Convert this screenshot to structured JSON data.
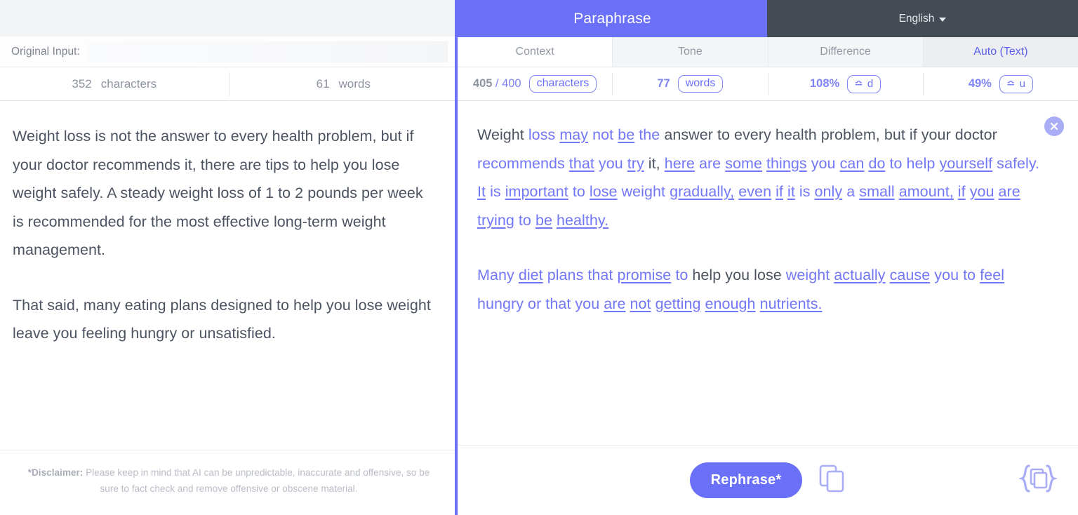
{
  "left": {
    "original_input_label": "Original Input:",
    "stats": [
      {
        "value": "352",
        "unit": "characters"
      },
      {
        "value": "61",
        "unit": "words"
      }
    ],
    "paragraphs": [
      "Weight loss is not the answer to every health problem, but if your doctor recommends it, there are tips to help you lose weight safely. A steady weight loss of 1 to 2 pounds per week is recommended for the most effective long-term weight management.",
      "That said, many eating plans designed to help you lose weight leave you feeling hungry or unsatisfied."
    ],
    "disclaimer_label": "*Disclaimer:",
    "disclaimer_text": " Please keep in mind that AI can be unpredictable, inaccurate and offensive, so be sure to fact check and remove offensive or obscene material."
  },
  "right": {
    "header_title": "Paraphrase",
    "language": "English",
    "tabs": [
      {
        "label": "Context",
        "state": "white"
      },
      {
        "label": "Tone",
        "state": "gray"
      },
      {
        "label": "Difference",
        "state": "gray"
      },
      {
        "label": "Auto (Text)",
        "state": "active"
      }
    ],
    "stats": {
      "chars_current": "405",
      "chars_limit": "/ 400",
      "chars_pill": "characters",
      "words_value": "77",
      "words_pill": "words",
      "difference_value": "108%",
      "difference_pill": "≏ d",
      "unique_value": "49%",
      "unique_pill": "≏ u"
    },
    "paragraphs": [
      [
        {
          "t": "Weight ",
          "s": "plain"
        },
        {
          "t": "loss ",
          "s": "acc"
        },
        {
          "t": "may",
          "s": "acc-u"
        },
        {
          "t": " ",
          "s": "plain"
        },
        {
          "t": "not ",
          "s": "acc"
        },
        {
          "t": "be",
          "s": "acc-u"
        },
        {
          "t": " ",
          "s": "plain"
        },
        {
          "t": "the ",
          "s": "acc"
        },
        {
          "t": "answer to every health problem, but if your doctor ",
          "s": "plain"
        },
        {
          "t": "recommends ",
          "s": "acc"
        },
        {
          "t": "that",
          "s": "acc-u"
        },
        {
          "t": " ",
          "s": "plain"
        },
        {
          "t": "you ",
          "s": "acc"
        },
        {
          "t": "try",
          "s": "acc-u"
        },
        {
          "t": " it, ",
          "s": "plain"
        },
        {
          "t": "here",
          "s": "acc-u"
        },
        {
          "t": " ",
          "s": "plain"
        },
        {
          "t": "are ",
          "s": "acc"
        },
        {
          "t": "some",
          "s": "acc-u"
        },
        {
          "t": " ",
          "s": "plain"
        },
        {
          "t": "things",
          "s": "acc-u"
        },
        {
          "t": " ",
          "s": "plain"
        },
        {
          "t": "you",
          "s": "acc"
        },
        {
          "t": " ",
          "s": "plain"
        },
        {
          "t": "can",
          "s": "acc-u"
        },
        {
          "t": " ",
          "s": "plain"
        },
        {
          "t": "do",
          "s": "acc-u"
        },
        {
          "t": " ",
          "s": "plain"
        },
        {
          "t": "to help ",
          "s": "acc"
        },
        {
          "t": "yourself",
          "s": "acc-u"
        },
        {
          "t": " ",
          "s": "plain"
        },
        {
          "t": "safely. ",
          "s": "acc"
        },
        {
          "t": "It",
          "s": "acc-u"
        },
        {
          "t": " ",
          "s": "plain"
        },
        {
          "t": "is ",
          "s": "acc"
        },
        {
          "t": "important",
          "s": "acc-u"
        },
        {
          "t": " ",
          "s": "plain"
        },
        {
          "t": "to ",
          "s": "acc"
        },
        {
          "t": "lose",
          "s": "acc-u"
        },
        {
          "t": " ",
          "s": "plain"
        },
        {
          "t": "weight ",
          "s": "acc"
        },
        {
          "t": "gradually,",
          "s": "acc-u"
        },
        {
          "t": " ",
          "s": "plain"
        },
        {
          "t": "even",
          "s": "acc-u"
        },
        {
          "t": " ",
          "s": "plain"
        },
        {
          "t": "if",
          "s": "acc-u"
        },
        {
          "t": " ",
          "s": "plain"
        },
        {
          "t": "it",
          "s": "acc-u"
        },
        {
          "t": " ",
          "s": "plain"
        },
        {
          "t": "is ",
          "s": "acc"
        },
        {
          "t": "only",
          "s": "acc-u"
        },
        {
          "t": " ",
          "s": "plain"
        },
        {
          "t": "a ",
          "s": "acc"
        },
        {
          "t": "small",
          "s": "acc-u"
        },
        {
          "t": " ",
          "s": "plain"
        },
        {
          "t": "amount,",
          "s": "acc-u"
        },
        {
          "t": " ",
          "s": "plain"
        },
        {
          "t": "if",
          "s": "acc-u"
        },
        {
          "t": " ",
          "s": "plain"
        },
        {
          "t": "you",
          "s": "acc-u"
        },
        {
          "t": " ",
          "s": "plain"
        },
        {
          "t": "are",
          "s": "acc-u"
        },
        {
          "t": " ",
          "s": "plain"
        },
        {
          "t": "trying",
          "s": "acc-u"
        },
        {
          "t": " ",
          "s": "plain"
        },
        {
          "t": "to ",
          "s": "acc"
        },
        {
          "t": "be",
          "s": "acc-u"
        },
        {
          "t": " ",
          "s": "plain"
        },
        {
          "t": "healthy.",
          "s": "acc-u"
        }
      ],
      [
        {
          "t": "Many ",
          "s": "acc"
        },
        {
          "t": "diet",
          "s": "acc-u"
        },
        {
          "t": " ",
          "s": "plain"
        },
        {
          "t": "plans that ",
          "s": "acc"
        },
        {
          "t": "promise",
          "s": "acc-u"
        },
        {
          "t": " ",
          "s": "plain"
        },
        {
          "t": "to ",
          "s": "acc"
        },
        {
          "t": "help you lose ",
          "s": "plain"
        },
        {
          "t": "weight ",
          "s": "acc"
        },
        {
          "t": "actually",
          "s": "acc-u"
        },
        {
          "t": " ",
          "s": "plain"
        },
        {
          "t": "cause",
          "s": "acc-u"
        },
        {
          "t": " ",
          "s": "plain"
        },
        {
          "t": "you to ",
          "s": "acc"
        },
        {
          "t": "feel",
          "s": "acc-u"
        },
        {
          "t": " ",
          "s": "plain"
        },
        {
          "t": "hungry or that you ",
          "s": "acc"
        },
        {
          "t": "are",
          "s": "acc-u"
        },
        {
          "t": " ",
          "s": "plain"
        },
        {
          "t": "not",
          "s": "acc-u"
        },
        {
          "t": " ",
          "s": "plain"
        },
        {
          "t": "getting",
          "s": "acc-u"
        },
        {
          "t": " ",
          "s": "plain"
        },
        {
          "t": "enough",
          "s": "acc-u"
        },
        {
          "t": " ",
          "s": "plain"
        },
        {
          "t": "nutrients.",
          "s": "acc-u"
        }
      ]
    ],
    "rephrase_button": "Rephrase*",
    "icons": {
      "close": "close-circle-icon",
      "copy": "copy-icon",
      "braces": "braces-copy-icon"
    }
  },
  "colors": {
    "accent_purple": "#6b70f8",
    "header_dark": "#454b54",
    "text_gray": "#4c5361",
    "muted_gray": "#8d94a0"
  }
}
